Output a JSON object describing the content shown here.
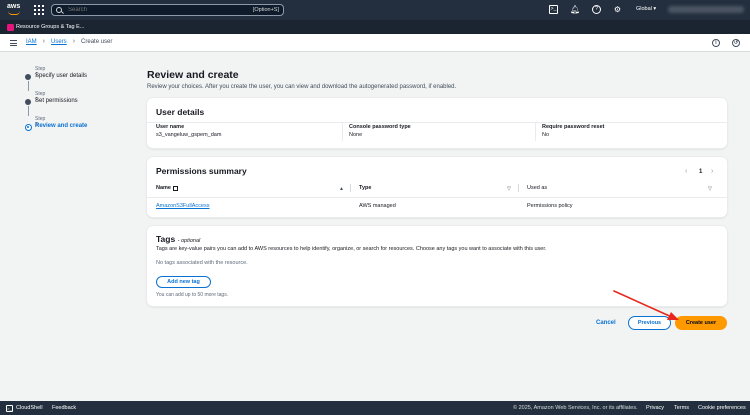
{
  "topnav": {
    "search_placeholder": "Search",
    "search_shortcut": "[Option+S]",
    "region": "Global ▾"
  },
  "favorites": {
    "item": "Resource Groups & Tag E..."
  },
  "breadcrumb": {
    "iam": "IAM",
    "users": "Users",
    "current": "Create user"
  },
  "steps": [
    {
      "label": "Step 1",
      "title": "Specify user details"
    },
    {
      "label": "Step 2",
      "title": "Set permissions"
    },
    {
      "label": "Step 3",
      "title": "Review and create"
    }
  ],
  "main": {
    "title": "Review and create",
    "description": "Review your choices. After you create the user, you can view and download the autogenerated password, if enabled."
  },
  "user_details": {
    "title": "User details",
    "user_name_key": "User name",
    "user_name_val": "s3_vangeluw_gspem_dam",
    "console_pw_key": "Console password type",
    "console_pw_val": "None",
    "reset_key": "Require password reset",
    "reset_val": "No"
  },
  "permissions": {
    "title": "Permissions summary",
    "page": "1",
    "col_name": "Name",
    "col_type": "Type",
    "col_used": "Used as",
    "rows": [
      {
        "name": "AmazonS3FullAccess",
        "type": "AWS managed",
        "used": "Permissions policy"
      }
    ]
  },
  "tags": {
    "title": "Tags",
    "optional": "- optional",
    "description": "Tags are key-value pairs you can add to AWS resources to help identify, organize, or search for resources. Choose any tags you want to associate with this user.",
    "empty": "No tags associated with the resource.",
    "add_button": "Add new tag",
    "hint": "You can add up to 50 more tags."
  },
  "actions": {
    "cancel": "Cancel",
    "previous": "Previous",
    "create": "Create user"
  },
  "footer": {
    "cloudshell": "CloudShell",
    "feedback": "Feedback",
    "copyright": "© 2025, Amazon Web Services, Inc. or its affiliates.",
    "privacy": "Privacy",
    "terms": "Terms",
    "cookies": "Cookie preferences"
  },
  "colors": {
    "nav": "#232f3e",
    "link": "#0972d3",
    "primary": "#ff9900",
    "annotation": "#e8281f"
  }
}
